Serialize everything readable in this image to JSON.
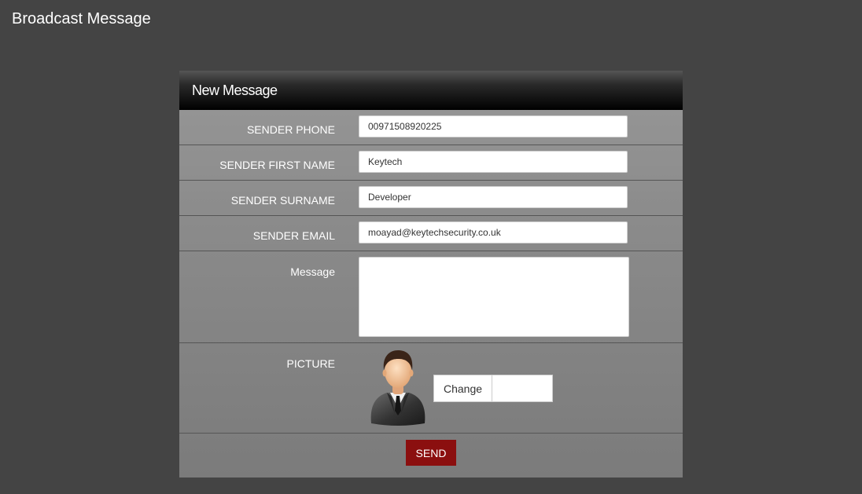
{
  "page": {
    "title": "Broadcast Message"
  },
  "panel": {
    "title": "New Message"
  },
  "form": {
    "sender_phone": {
      "label": "SENDER PHONE",
      "value": "00971508920225"
    },
    "sender_first_name": {
      "label": "SENDER FIRST NAME",
      "value": "Keytech"
    },
    "sender_surname": {
      "label": "SENDER SURNAME",
      "value": "Developer"
    },
    "sender_email": {
      "label": "SENDER EMAIL",
      "value": "moayad@keytechsecurity.co.uk"
    },
    "message": {
      "label": "Message",
      "value": ""
    },
    "picture": {
      "label": "PICTURE",
      "icon": "user-avatar-icon",
      "change_label": "Change"
    },
    "send_label": "SEND"
  },
  "colors": {
    "background": "#444444",
    "header": "#000000",
    "send_button": "#8b0f0f"
  }
}
